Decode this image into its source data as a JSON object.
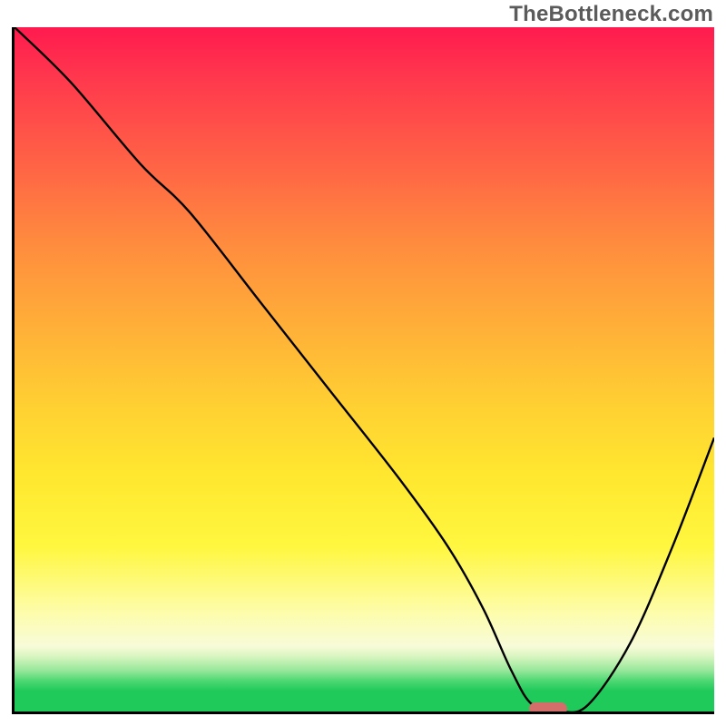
{
  "watermark": "TheBottleneck.com",
  "colors": {
    "grad_top": "#ff1a4f",
    "grad_bottom": "#1fc95a",
    "curve": "#000000",
    "axis": "#000000",
    "marker": "#d36e6a"
  },
  "chart_data": {
    "type": "line",
    "title": "",
    "xlabel": "",
    "ylabel": "",
    "xlim": [
      0,
      100
    ],
    "ylim": [
      0,
      100
    ],
    "x": [
      0,
      8,
      18,
      25,
      35,
      45,
      55,
      62,
      67,
      71,
      74,
      78,
      82,
      88,
      94,
      100
    ],
    "values": [
      100,
      92,
      80,
      73,
      60,
      47,
      34,
      24,
      15,
      6,
      1,
      0,
      1,
      10,
      24,
      40
    ],
    "min_marker": {
      "x": 76,
      "y": 0
    }
  }
}
